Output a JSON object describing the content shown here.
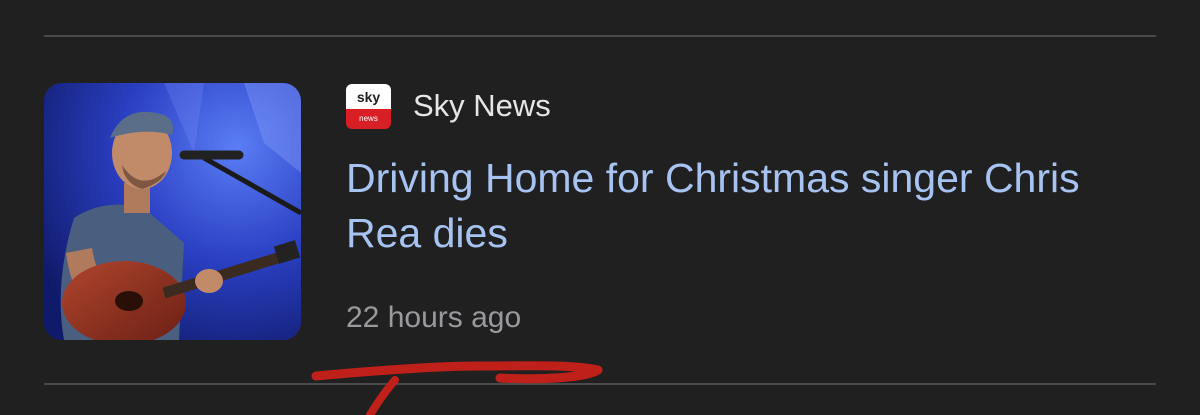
{
  "article": {
    "source": {
      "name": "Sky News",
      "logo_text": "sky",
      "logo_subtext": "news",
      "logo_colors": {
        "top": "#ffffff",
        "bottom": "#d91f26"
      }
    },
    "headline": "Driving Home for Christmas singer Chris Rea dies",
    "timestamp": "22 hours ago",
    "thumbnail_icon": "singer-with-guitar-photo"
  },
  "colors": {
    "background": "#202020",
    "divider": "#4a4a4c",
    "headline": "#a7c3f2",
    "source_text": "#e6e6e6",
    "timestamp": "#9a9a9e",
    "annotation": "#c0201a"
  }
}
